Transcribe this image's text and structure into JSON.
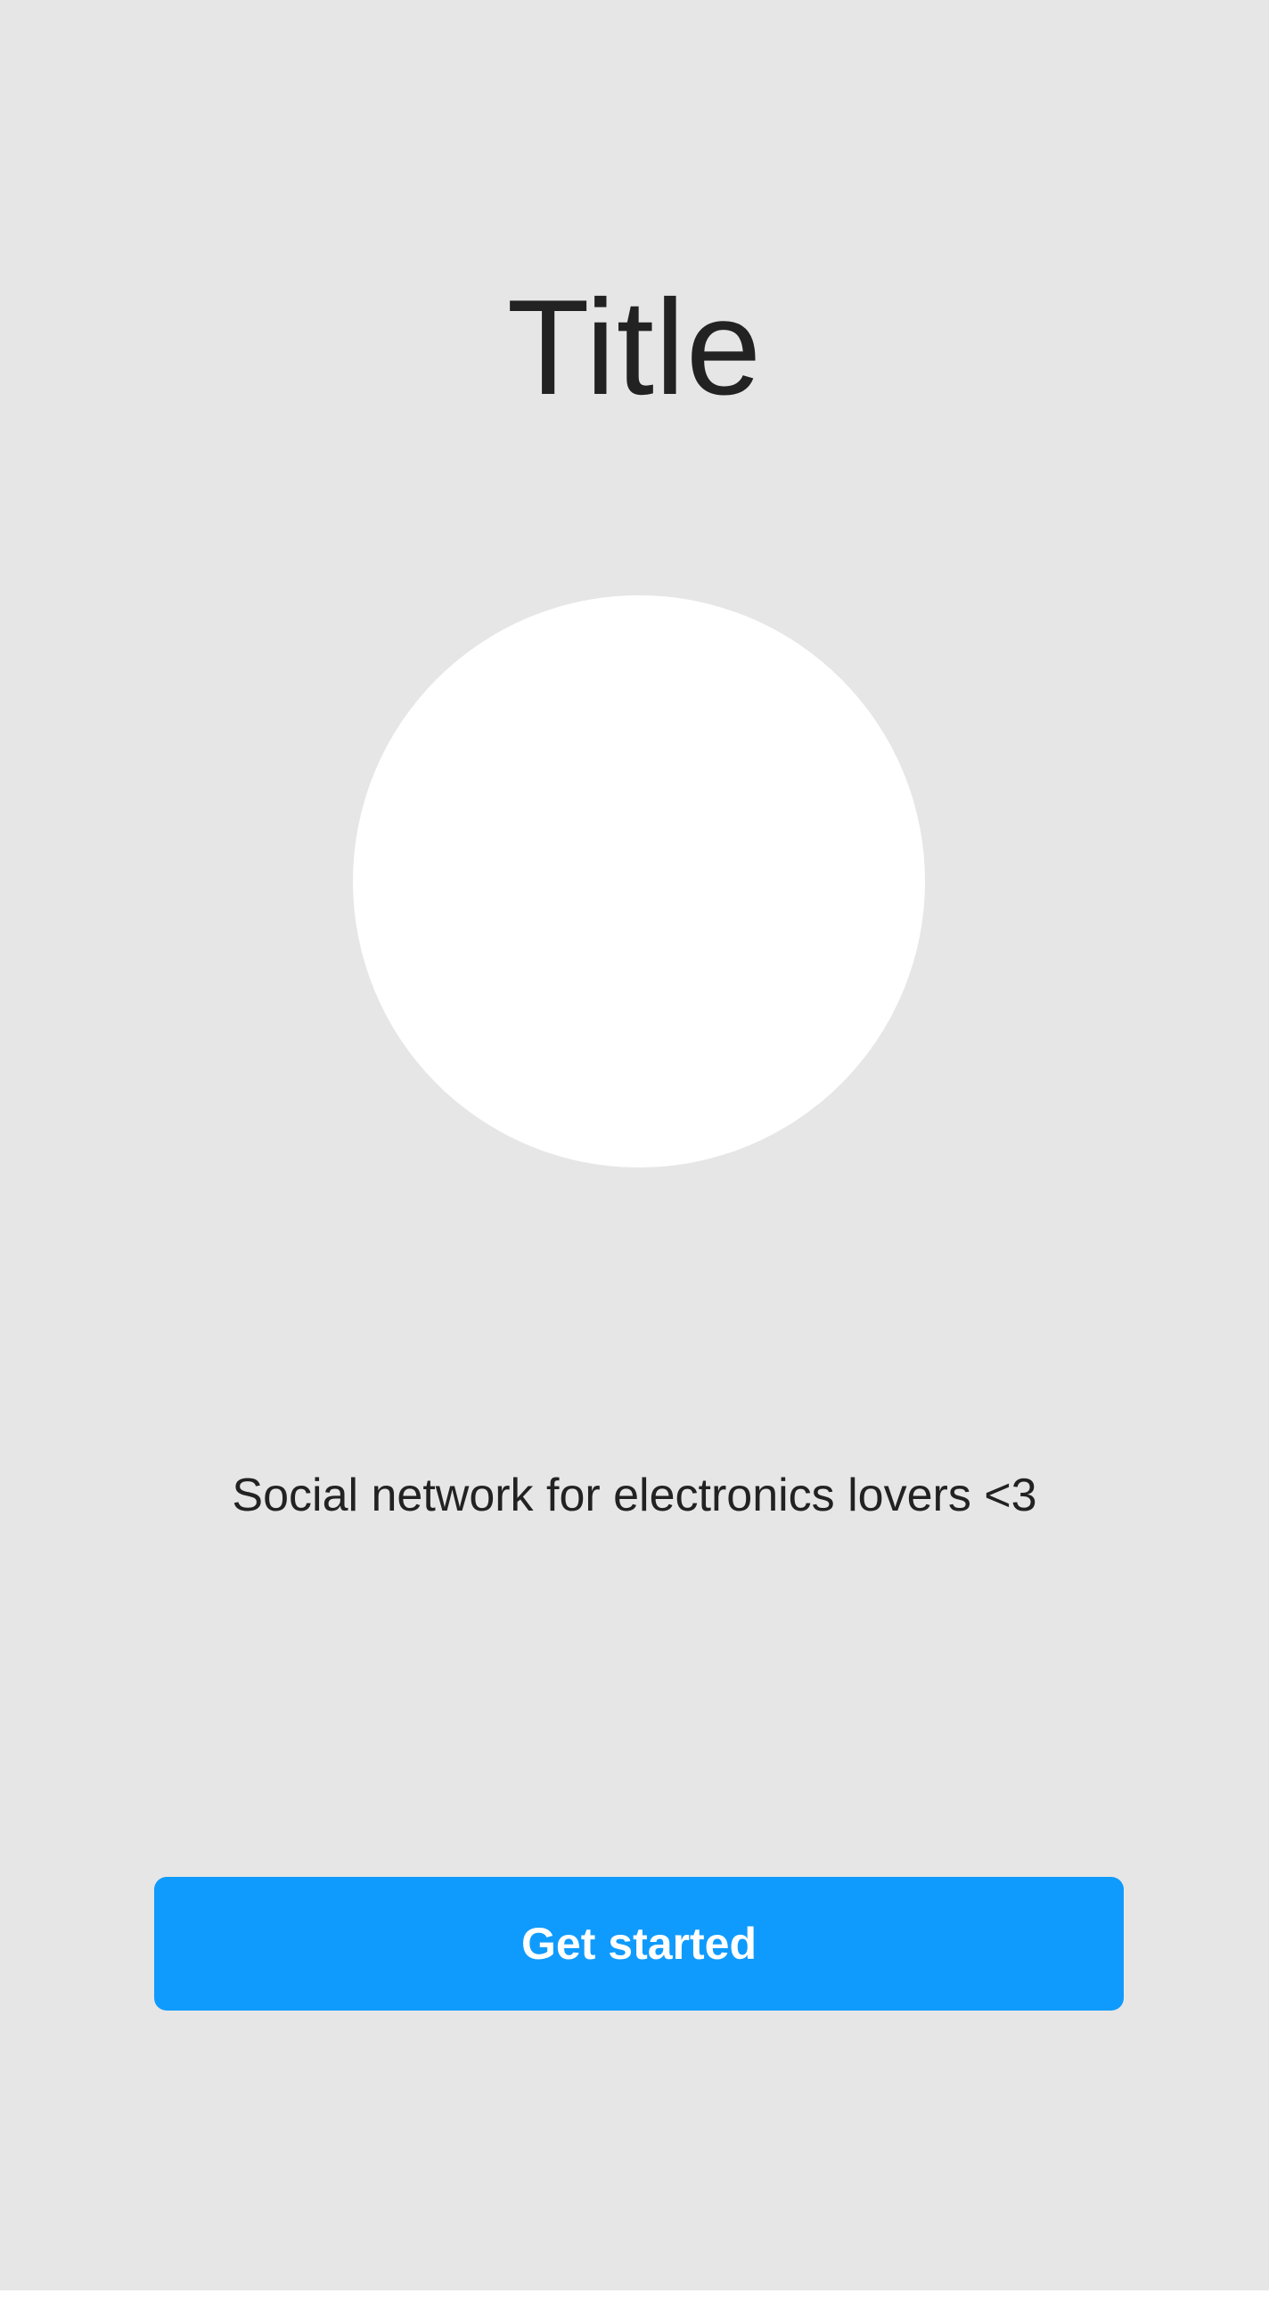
{
  "onboarding": {
    "title": "Title",
    "tagline": "Social network for electronics lovers <3",
    "cta_label": "Get started"
  },
  "colors": {
    "background": "#e6e6e6",
    "image_placeholder": "#ffffff",
    "text": "#222222",
    "accent": "#0f9bfd",
    "button_text": "#ffffff"
  }
}
